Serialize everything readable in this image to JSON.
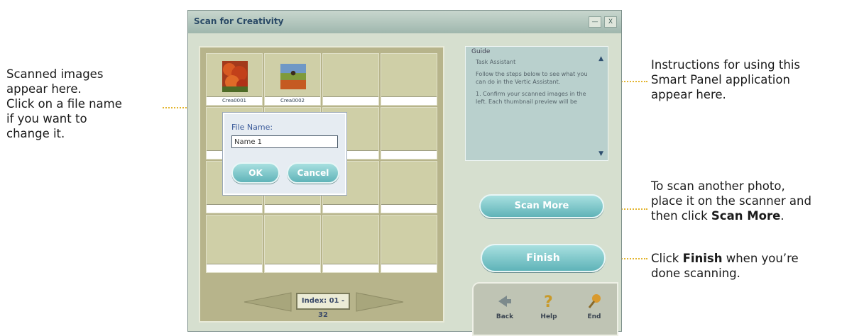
{
  "annotations": {
    "left": [
      "Scanned images",
      "appear here.",
      "Click on a file name",
      "if you want to",
      "change it."
    ],
    "instructions": [
      "Instructions for using this",
      "Smart Panel application",
      "appear here."
    ],
    "scan_more_line1": "To scan another photo,",
    "scan_more_line2": "place it on the scanner and",
    "scan_more_line3_prefix": "then click ",
    "scan_more_line3_bold": "Scan More",
    "scan_more_line3_suffix": ".",
    "finish_prefix": "Click ",
    "finish_bold": "Finish",
    "finish_suffix": " when you’re",
    "finish_line2": "done scanning."
  },
  "window": {
    "title": "Scan for Creativity",
    "minimize": "—",
    "close": "X"
  },
  "grid": {
    "captions": [
      "Crea0001",
      "Crea0002"
    ]
  },
  "dialog": {
    "label": "File Name:",
    "value": "Name 1",
    "ok": "OK",
    "cancel": "Cancel"
  },
  "nav": {
    "page_indicator": "Index: 01 - 32"
  },
  "guide": {
    "title": "Guide",
    "paragraphs": [
      "Task Assistant",
      "Follow the steps below to see what you can do in the Vertic Assistant.",
      "1. Confirm your scanned images in the left. Each thumbnail preview will be"
    ]
  },
  "buttons": {
    "scan_more": "Scan More",
    "finish": "Finish"
  },
  "bottom": {
    "back": "Back",
    "help": "Help",
    "end": "End"
  },
  "colors": {
    "accent_pill": "#5fb3b8",
    "leader_dots": "#e3b52e",
    "window_title": "#2a4a66"
  }
}
